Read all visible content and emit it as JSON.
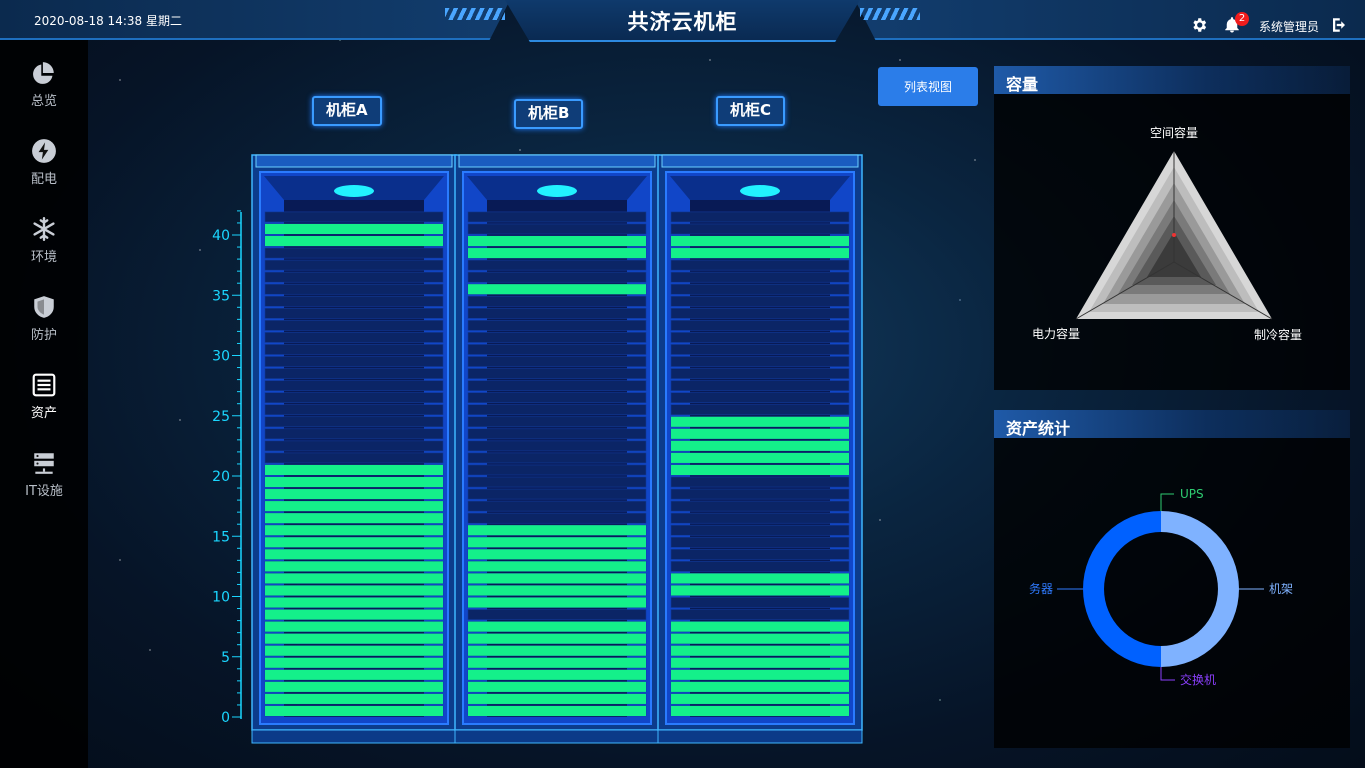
{
  "header": {
    "datetime": "2020-08-18 14:38 星期二",
    "title": "共济云机柜",
    "notification_count": "2",
    "user_name": "系统管理员"
  },
  "sidebar": {
    "items": [
      {
        "label": "总览",
        "icon": "pie-chart-icon"
      },
      {
        "label": "配电",
        "icon": "lightning-icon"
      },
      {
        "label": "环境",
        "icon": "snowflake-icon"
      },
      {
        "label": "防护",
        "icon": "shield-icon"
      },
      {
        "label": "资产",
        "icon": "server-list-icon",
        "active": true
      },
      {
        "label": "IT设施",
        "icon": "server-rack-icon"
      }
    ]
  },
  "toolbar": {
    "list_view_label": "列表视图"
  },
  "racks": {
    "scale_ticks": [
      "40",
      "35",
      "30",
      "25",
      "20",
      "15",
      "10",
      "5",
      "0"
    ],
    "units_total": 45,
    "items": [
      {
        "label": "机柜A",
        "occupied_units": [
          [
            1,
            21
          ],
          [
            40,
            41
          ]
        ]
      },
      {
        "label": "机柜B",
        "occupied_units": [
          [
            1,
            8
          ],
          [
            10,
            16
          ],
          [
            36,
            36
          ],
          [
            39,
            40
          ]
        ]
      },
      {
        "label": "机柜C",
        "occupied_units": [
          [
            1,
            8
          ],
          [
            11,
            12
          ],
          [
            21,
            25
          ],
          [
            39,
            40
          ]
        ]
      }
    ]
  },
  "capacity": {
    "title": "容量",
    "labels": {
      "space": "空间容量",
      "power": "电力容量",
      "cooling": "制冷容量"
    }
  },
  "asset_stats": {
    "title": "资产统计",
    "labels": {
      "ups": "UPS",
      "rack": "机架",
      "switch": "交换机",
      "server": "务器"
    },
    "colors": {
      "ups": "#2ecc71",
      "rack": "#7fb2ff",
      "switch": "#8a3ffc",
      "server": "#0061ff"
    }
  },
  "colors": {
    "occupied": "#14f08a",
    "accent": "#2b7de9",
    "scale": "#1ad6ff"
  }
}
